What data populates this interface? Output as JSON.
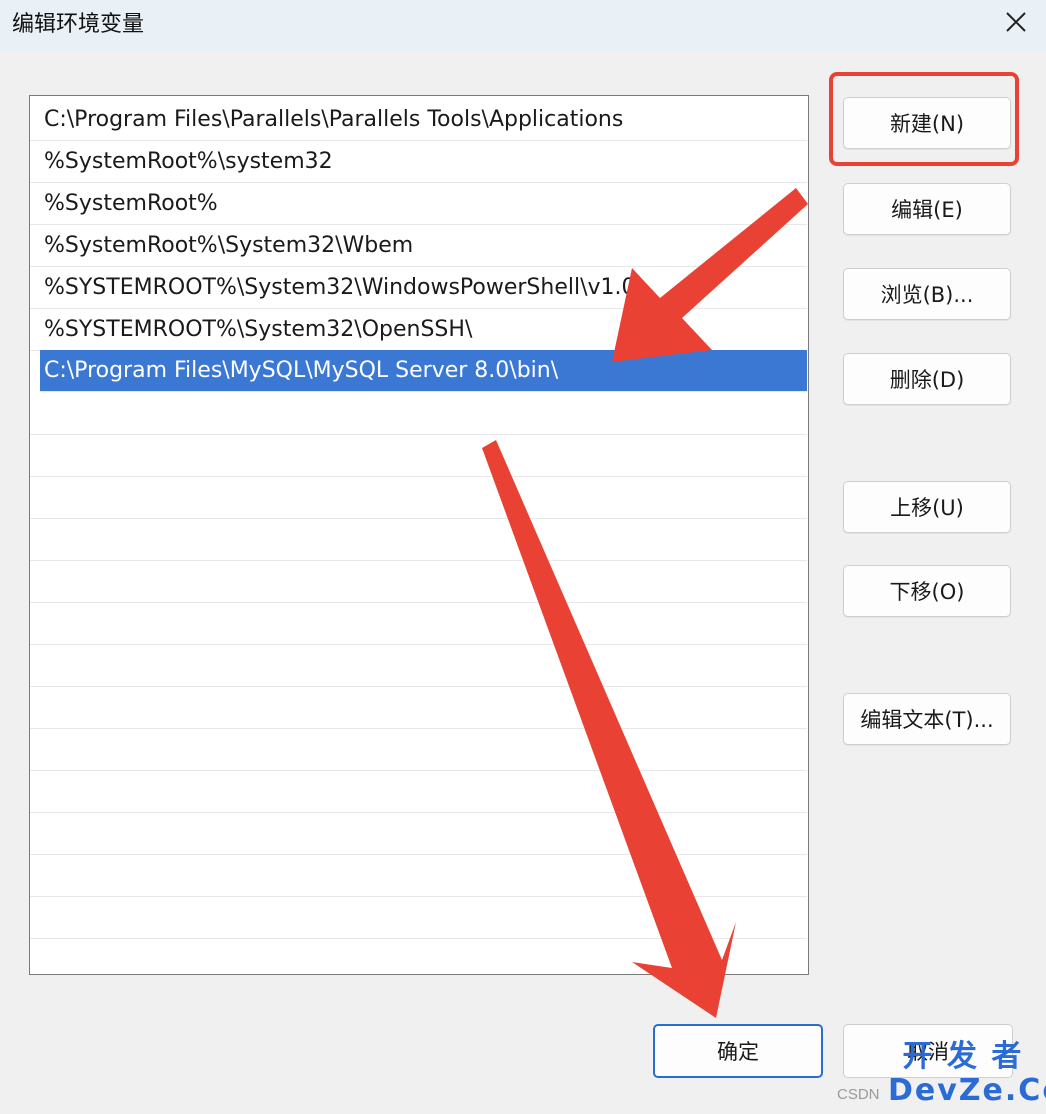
{
  "dialog": {
    "title": "编辑环境变量",
    "close_glyph": "✕"
  },
  "path_list": {
    "items": [
      "C:\\Program Files\\Parallels\\Parallels Tools\\Applications",
      "%SystemRoot%\\system32",
      "%SystemRoot%",
      "%SystemRoot%\\System32\\Wbem",
      "%SYSTEMROOT%\\System32\\WindowsPowerShell\\v1.0\\",
      "%SYSTEMROOT%\\System32\\OpenSSH\\",
      "C:\\Program Files\\MySQL\\MySQL Server 8.0\\bin\\"
    ],
    "selected_index": 6
  },
  "buttons": {
    "new": "新建(N)",
    "edit": "编辑(E)",
    "browse": "浏览(B)...",
    "delete": "删除(D)",
    "move_up": "上移(U)",
    "move_down": "下移(O)",
    "edit_text": "编辑文本(T)...",
    "ok": "确定",
    "cancel": "取消"
  },
  "watermark": {
    "line1": "开 发 者",
    "line2": "DevZe.CoM",
    "small": "CSDN"
  },
  "colors": {
    "selection": "#3b78d4",
    "annotation": "#e94234",
    "titlebar": "#e9f1f6",
    "ok_border": "#2a6dd0"
  }
}
